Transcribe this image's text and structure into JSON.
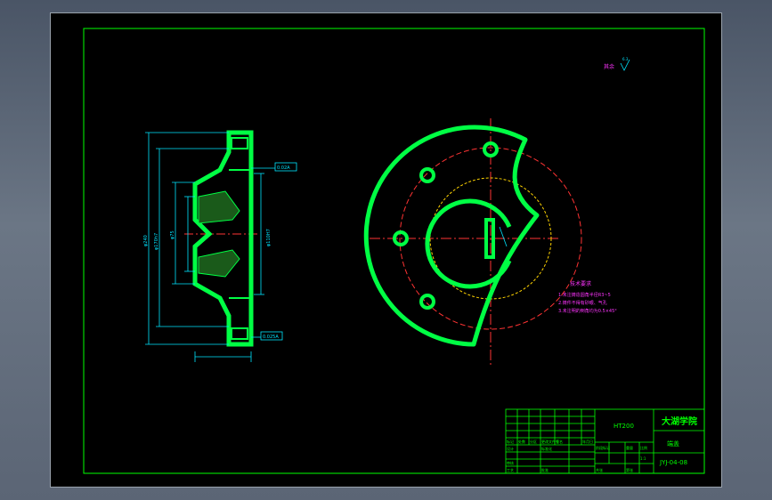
{
  "drawing": {
    "finish_symbol": {
      "label": "其余",
      "value": "6.3"
    },
    "section_view": {
      "dims": {
        "top_callout": "0.02A",
        "bottom_callout": "0.025A",
        "dia_outer": "φ240",
        "dia_bore": "φ170h7",
        "dia_inner": "φ75",
        "dia_hub": "φ110H7"
      }
    },
    "tech_requirements": {
      "heading": "技术要求",
      "items": [
        "1.未注铸造圆角半径R3~5",
        "2.铸件不得有砂眼、气孔",
        "3.未注明的倒角均为0.5×45°"
      ]
    },
    "title_block": {
      "school": "大湖学院",
      "part_name": "端盖",
      "material": "HT200",
      "drawing_no": "JYJ-04-08",
      "scale": "1:1",
      "head_cells": [
        "标记",
        "处数",
        "分区",
        "更改文件号",
        "签名",
        "年月日"
      ],
      "sign_cells": [
        "设计",
        "标准化",
        "审核",
        "工艺",
        "批准"
      ],
      "stage_cells": [
        "阶段标记",
        "重量",
        "比例"
      ],
      "sheet_cells": [
        "共张",
        "第张"
      ]
    }
  }
}
